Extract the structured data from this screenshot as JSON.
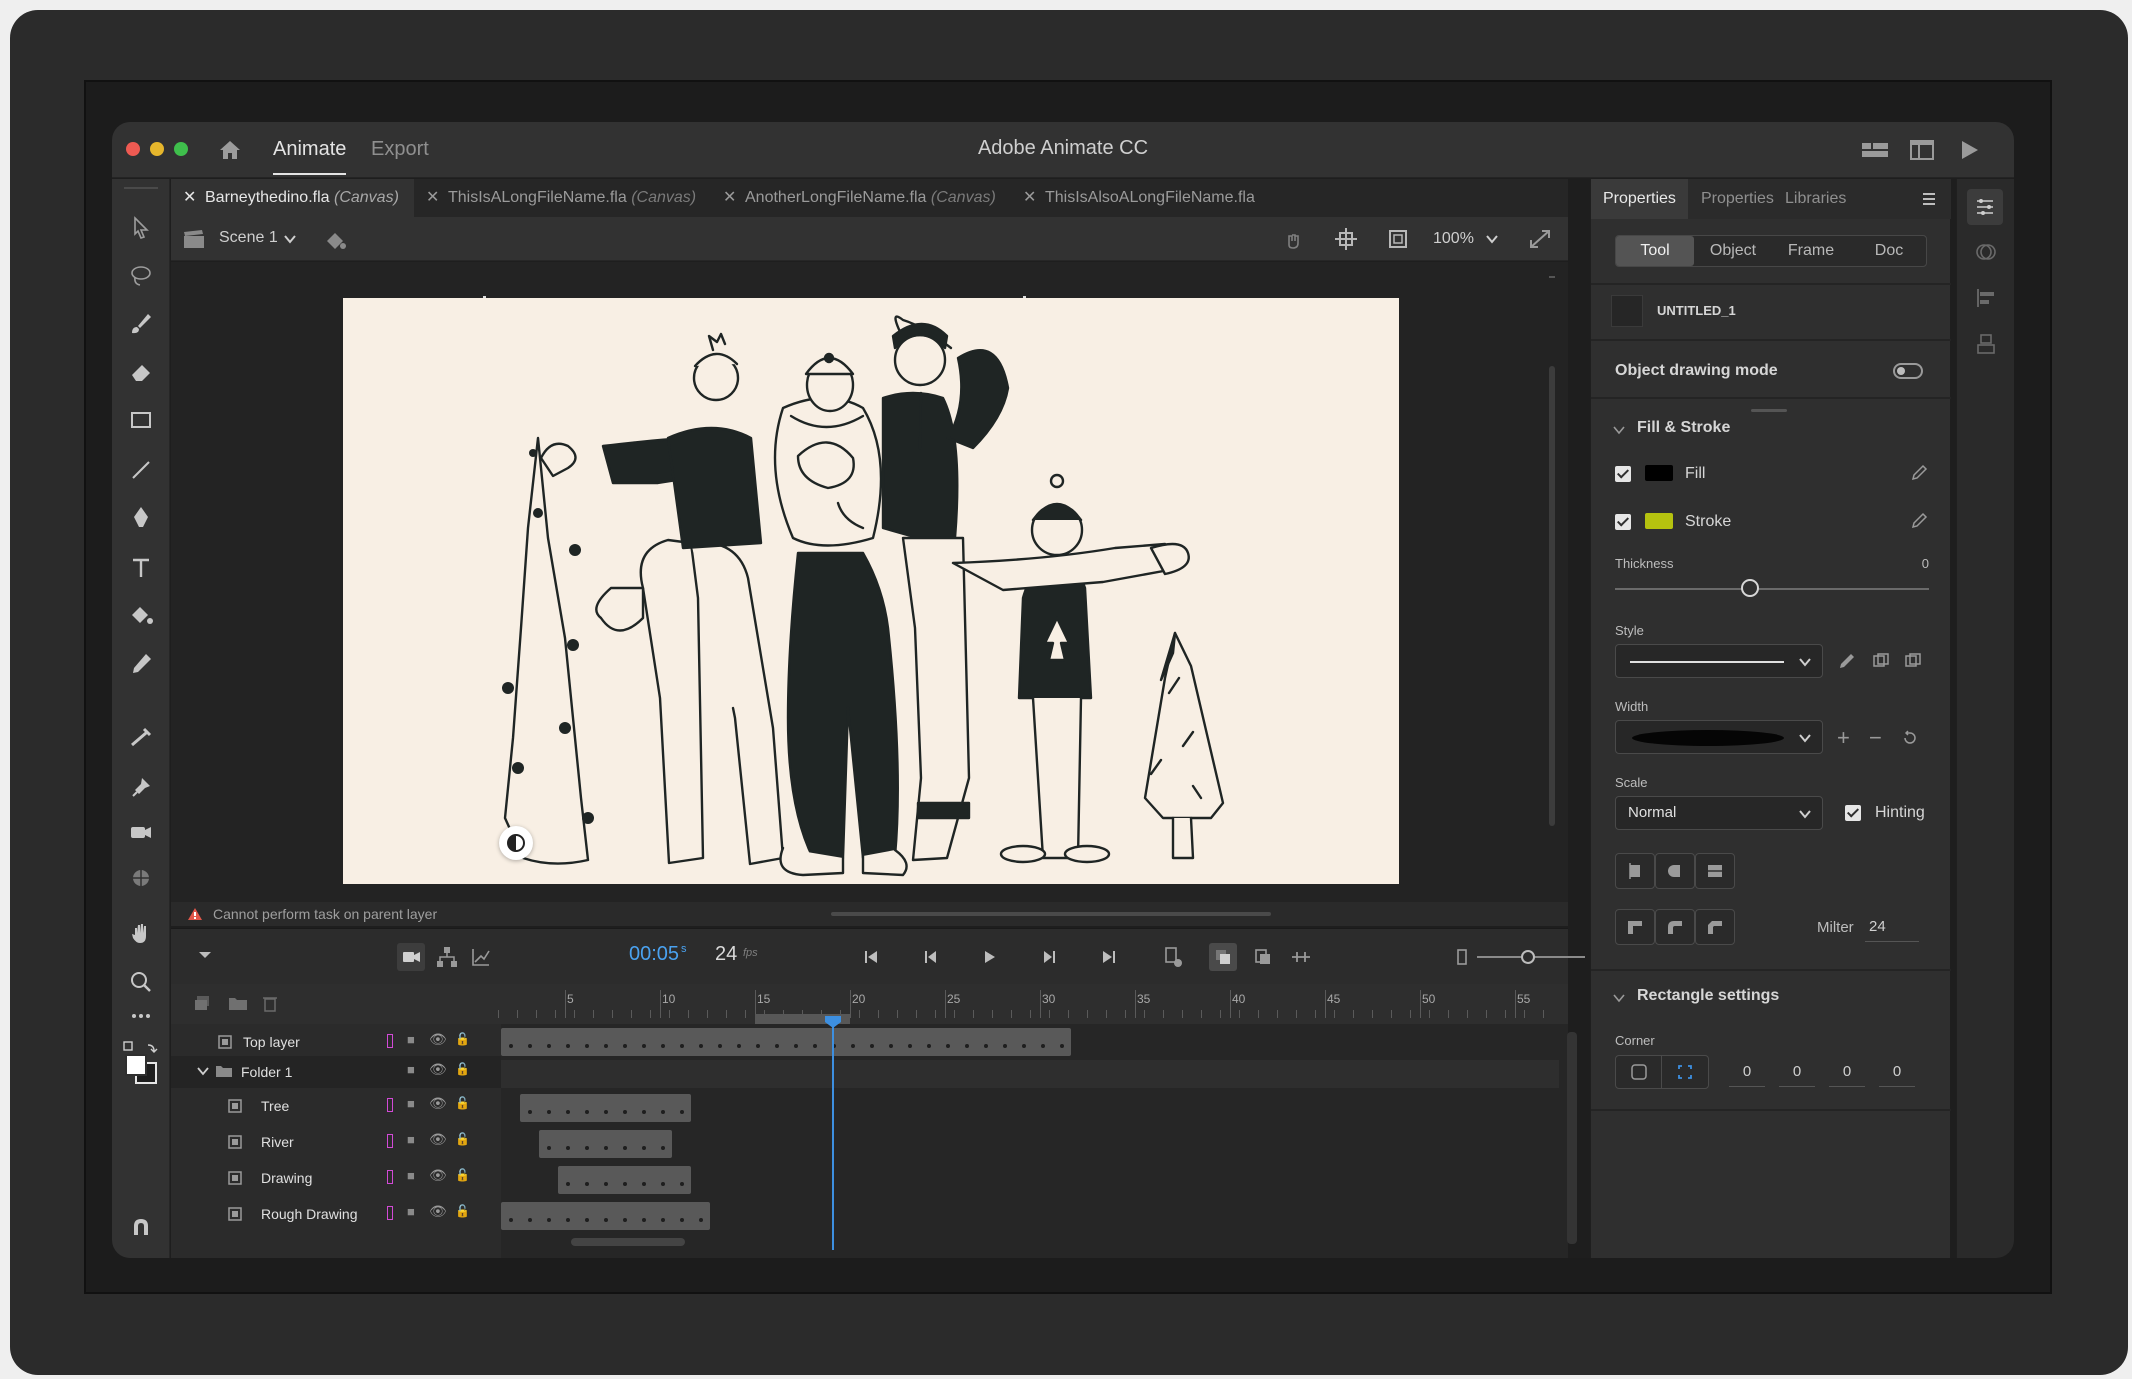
{
  "titlebar": {
    "workspaces": [
      "Animate",
      "Export"
    ],
    "app_title": "Adobe Animate CC"
  },
  "doc_tabs": [
    {
      "name": "Barneythedino.fla",
      "tag": "(Canvas)"
    },
    {
      "name": "ThisIsALongFileName.fla",
      "tag": "(Canvas)"
    },
    {
      "name": "AnotherLongFileName.fla",
      "tag": "(Canvas)"
    },
    {
      "name": "ThisIsAlsoALongFileName.fla",
      "tag": ""
    }
  ],
  "scene": {
    "label": "Scene 1",
    "zoom": "100%"
  },
  "warning": "Cannot perform task on parent layer",
  "timeline": {
    "time": "00:05",
    "time_unit": "s",
    "fps": "24",
    "fps_unit": "fps",
    "ruler_labels": [
      "5",
      "10",
      "15",
      "20",
      "25",
      "30",
      "35",
      "40",
      "45",
      "50",
      "55"
    ],
    "playhead_frame": 18,
    "layers": [
      {
        "name": "Top layer"
      },
      {
        "name": "Folder 1"
      },
      {
        "name": "Tree"
      },
      {
        "name": "River"
      },
      {
        "name": "Drawing"
      },
      {
        "name": "Rough Drawing"
      }
    ]
  },
  "properties": {
    "tabs": [
      "Properties",
      "Properties",
      "Libraries"
    ],
    "segments": [
      "Tool",
      "Object",
      "Frame",
      "Doc"
    ],
    "symbol_name": "UNTITLED_1",
    "object_drawing_mode": "Object drawing mode",
    "fill_stroke": {
      "title": "Fill & Stroke",
      "fill_label": "Fill",
      "fill_color": "#000000",
      "stroke_label": "Stroke",
      "stroke_color": "#b5c20f",
      "thickness_label": "Thickness",
      "thickness_value": "0",
      "style_label": "Style",
      "width_label": "Width",
      "scale_label": "Scale",
      "scale_value": "Normal",
      "hinting_label": "Hinting",
      "miter_label": "Milter",
      "miter_value": "24"
    },
    "rectangle": {
      "title": "Rectangle settings",
      "corner_label": "Corner",
      "corners": [
        "0",
        "0",
        "0",
        "0"
      ]
    }
  },
  "colors": {
    "accent": "#3d8fe0",
    "layer_outline": "#d24ad6",
    "stage_bg": "#f8efe4",
    "ink": "#1f2524"
  }
}
